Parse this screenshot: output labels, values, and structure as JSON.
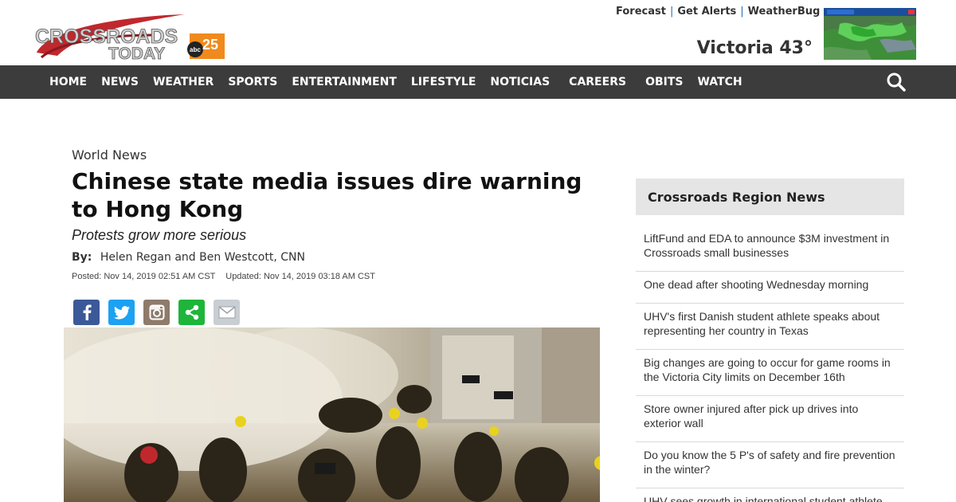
{
  "header": {
    "logo_text": "CROSSROADS TODAY",
    "logo_badge": "abc 25",
    "top_links": [
      "Forecast",
      "Get Alerts",
      "WeatherBug"
    ],
    "weather": "Victoria 43°"
  },
  "nav": {
    "items": [
      "HOME",
      "NEWS",
      "WEATHER",
      "SPORTS",
      "ENTERTAINMENT",
      "LIFESTYLE",
      "NOTICIAS",
      "CAREERS",
      "OBITS",
      "WATCH"
    ]
  },
  "article": {
    "category": "World News",
    "headline": "Chinese state media issues dire warning to Hong Kong",
    "subhead": "Protests grow more serious",
    "by_label": "By:",
    "authors": "Helen Regan and Ben Westcott, CNN",
    "posted": "Posted: Nov 14, 2019 02:51 AM CST",
    "updated": "Updated: Nov 14, 2019 03:18 AM CST",
    "share_icons": [
      "facebook-icon",
      "twitter-icon",
      "instagram-icon",
      "share-icon",
      "email-icon"
    ]
  },
  "sidebar": {
    "title": "Crossroads Region News",
    "items": [
      "LiftFund and EDA to announce $3M investment in Crossroads small businesses",
      "One dead after shooting Wednesday morning",
      "UHV's first Danish student athlete speaks about representing her country in Texas",
      "Big changes are going to occur for game rooms in the Victoria City limits on December 16th",
      "Store owner injured after pick up drives into exterior wall",
      "Do you know the 5 P's of safety and fire prevention in the winter?",
      "UHV sees growth in international student athlete"
    ]
  },
  "colors": {
    "nav_bg": "#3c3c3c",
    "logo_red": "#c0282d",
    "sidebar_head_bg": "#e5e5e5"
  }
}
